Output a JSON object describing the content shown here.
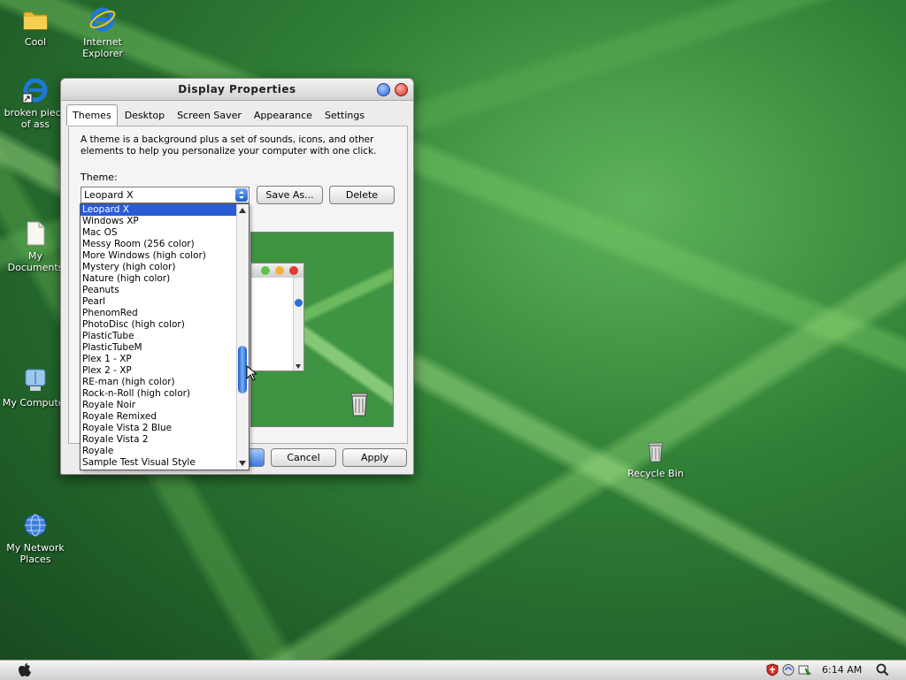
{
  "desktop_icons": [
    {
      "label": "Cool",
      "icon": "folder-icon"
    },
    {
      "label": "Internet Explorer",
      "icon": "internet-explorer-icon"
    },
    {
      "label": "broken piece of ass",
      "icon": "internet-explorer-shortcut-icon"
    },
    {
      "label": "My Documents",
      "icon": "documents-icon"
    },
    {
      "label": "My Computer",
      "icon": "computer-icon"
    },
    {
      "label": "My Network Places",
      "icon": "network-globe-icon"
    },
    {
      "label": "Recycle Bin",
      "icon": "trash-icon"
    }
  ],
  "window": {
    "title": "Display Properties",
    "tabs": [
      "Themes",
      "Desktop",
      "Screen Saver",
      "Appearance",
      "Settings"
    ],
    "active_tab": "Themes",
    "description": "A theme is a background plus a set of sounds, icons, and other elements to help you personalize your computer with one click.",
    "theme_label": "Theme:",
    "theme_selected": "Leopard X",
    "save_as_label": "Save As...",
    "delete_label": "Delete",
    "cancel_label": "Cancel",
    "apply_label": "Apply"
  },
  "dropdown": {
    "options": [
      "Leopard X",
      "Windows XP",
      "Mac OS",
      "Messy Room (256 color)",
      "More Windows (high color)",
      "Mystery (high color)",
      "Nature (high color)",
      "Peanuts",
      "Pearl",
      "PhenomRed",
      "PhotoDisc (high color)",
      "PlasticTube",
      "PlasticTubeM",
      "Plex 1 - XP",
      "Plex 2 - XP",
      "RE-man (high color)",
      "Rock-n-Roll (high color)",
      "Royale Noir",
      "Royale Remixed",
      "Royale Vista 2 Blue",
      "Royale Vista 2",
      "Royale",
      "Sample Test Visual Style"
    ],
    "selected_index": 0
  },
  "taskbar": {
    "clock": "6:14 AM"
  },
  "colors": {
    "selection": "#2a5cd6",
    "close_button": "#e0302a",
    "minimize_button": "#3b7be0"
  }
}
